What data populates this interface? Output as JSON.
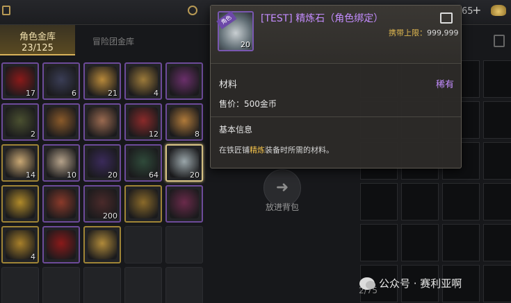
{
  "topbar": {
    "gold_count": "65",
    "plus_label": "+",
    "icons": [
      "lock-icon",
      "settings-icon",
      "gold-bag-icon"
    ]
  },
  "tabs": {
    "character_storage": {
      "label": "角色金库",
      "count": "23/125"
    },
    "adventure_storage": {
      "label": "冒险团金库"
    }
  },
  "inventory": {
    "slots": [
      {
        "icon": "rose-icon",
        "qty": "17",
        "rarity": "rare",
        "color": "#8a1a1a"
      },
      {
        "icon": "bomb-pouch-icon",
        "qty": "6",
        "rarity": "rare",
        "color": "#3a3d55"
      },
      {
        "icon": "scroll-map-icon",
        "qty": "21",
        "rarity": "rare",
        "color": "#b8893a"
      },
      {
        "icon": "treasure-chest-icon",
        "qty": "4",
        "rarity": "rare",
        "color": "#9c7a3a"
      },
      {
        "icon": "purple-ticket-icon",
        "qty": "",
        "rarity": "rare",
        "color": "#6a2f6a"
      },
      {
        "icon": "backpack-icon",
        "qty": "2",
        "rarity": "rare",
        "color": "#4a5030"
      },
      {
        "icon": "gold-sack-icon",
        "qty": "",
        "rarity": "rare",
        "color": "#8a5a2a"
      },
      {
        "icon": "recipe-paper-icon",
        "qty": "",
        "rarity": "rare",
        "color": "#9a6a50"
      },
      {
        "icon": "flower-bouquet-icon",
        "qty": "12",
        "rarity": "rare",
        "color": "#8a2a2a"
      },
      {
        "icon": "gift-box-icon",
        "qty": "8",
        "rarity": "rare",
        "color": "#b07a3a"
      },
      {
        "icon": "certificate-icon",
        "qty": "14",
        "rarity": "unique",
        "color": "#c9a874"
      },
      {
        "icon": "potion-bottle-icon",
        "qty": "10",
        "rarity": "rare",
        "color": "#b5a28a"
      },
      {
        "icon": "dark-vial-icon",
        "qty": "20",
        "rarity": "rare",
        "color": "#3a2a5a"
      },
      {
        "icon": "green-vial-icon",
        "qty": "64",
        "rarity": "rare",
        "color": "#2f4a3a"
      },
      {
        "icon": "refining-stone-icon",
        "qty": "20",
        "rarity": "rare",
        "color": "#9aa6aa",
        "selected": true
      },
      {
        "icon": "gold-coin-icon",
        "qty": "",
        "rarity": "unique",
        "color": "#b08a2a"
      },
      {
        "icon": "mystery-box-icon",
        "qty": "",
        "rarity": "rare",
        "color": "#8a3a2a"
      },
      {
        "icon": "wine-bottle-icon",
        "qty": "200",
        "rarity": "rare",
        "color": "#4a2a2a"
      },
      {
        "icon": "mystery-box-icon",
        "qty": "",
        "rarity": "unique",
        "color": "#8a6a2a"
      },
      {
        "icon": "jester-hat-icon",
        "qty": "",
        "rarity": "rare",
        "color": "#6a2a4a"
      },
      {
        "icon": "golden-leaf-icon",
        "qty": "4",
        "rarity": "unique",
        "color": "#a8802a"
      },
      {
        "icon": "red-orb-sword-icon",
        "qty": "",
        "rarity": "rare",
        "color": "#8a1a1a"
      },
      {
        "icon": "golden-box-icon",
        "qty": "",
        "rarity": "unique",
        "color": "#b08a3a"
      }
    ],
    "total_slots": 30
  },
  "transfer": {
    "label": "放进背包",
    "icon": "arrow-right-icon"
  },
  "storage_right": {
    "page": "2/75"
  },
  "tooltip": {
    "item_name": "[TEST] 精炼石（角色绑定）",
    "icon_tag": "角色",
    "icon_qty": "20",
    "carry_limit_label": "携带上限：",
    "carry_limit_value": "999,999",
    "category": "材料",
    "rarity": "稀有",
    "price": "售价：500金币",
    "basic_info": "基本信息",
    "desc_before": "在铁匠铺",
    "desc_highlight": "精炼",
    "desc_after": "装备时所需的材料。"
  },
  "watermark": {
    "text": "公众号 · 赛利亚啊"
  },
  "colors": {
    "accent_gold": "#d8b25a",
    "rarity_purple": "#c48dff",
    "highlight_yellow": "#f2c14b"
  }
}
